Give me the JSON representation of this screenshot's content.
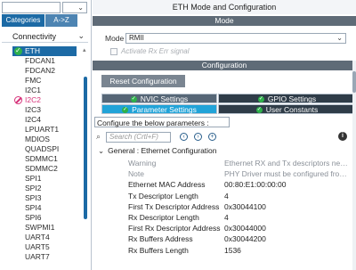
{
  "left_panel": {
    "tabs": {
      "categories": "Categories",
      "az": "A->Z"
    },
    "category": "Connectivity",
    "items": [
      {
        "label": "ETH",
        "state": "selected-ok"
      },
      {
        "label": "FDCAN1",
        "state": "normal"
      },
      {
        "label": "FDCAN2",
        "state": "normal"
      },
      {
        "label": "FMC",
        "state": "normal"
      },
      {
        "label": "I2C1",
        "state": "normal"
      },
      {
        "label": "I2C2",
        "state": "conflict"
      },
      {
        "label": "I2C3",
        "state": "normal"
      },
      {
        "label": "I2C4",
        "state": "normal"
      },
      {
        "label": "LPUART1",
        "state": "normal"
      },
      {
        "label": "MDIOS",
        "state": "normal"
      },
      {
        "label": "QUADSPI",
        "state": "normal"
      },
      {
        "label": "SDMMC1",
        "state": "normal"
      },
      {
        "label": "SDMMC2",
        "state": "normal"
      },
      {
        "label": "SPI1",
        "state": "normal"
      },
      {
        "label": "SPI2",
        "state": "normal"
      },
      {
        "label": "SPI3",
        "state": "normal"
      },
      {
        "label": "SPI4",
        "state": "normal"
      },
      {
        "label": "SPI6",
        "state": "normal"
      },
      {
        "label": "SWPMI1",
        "state": "normal"
      },
      {
        "label": "UART4",
        "state": "normal"
      },
      {
        "label": "UART5",
        "state": "normal"
      },
      {
        "label": "UART7",
        "state": "normal"
      }
    ]
  },
  "right_panel": {
    "title": "ETH Mode and Configuration",
    "mode_header": "Mode",
    "mode_label": "Mode",
    "mode_value": "RMII",
    "activate_label": "Activate Rx Err signal",
    "config_header": "Configuration",
    "reset_button": "Reset Configuration",
    "tabs": {
      "nvic": "NVIC Settings",
      "gpio": "GPIO Settings",
      "param": "Parameter Settings",
      "user": "User Constants"
    },
    "configure_label": "Configure the below parameters :",
    "search_placeholder": "Search (Crtl+F)",
    "group_title": "General : Ethernet Configuration",
    "params": [
      {
        "key": "Warning",
        "value": "Ethernet RX and Tx descriptors need...",
        "style": "dim"
      },
      {
        "key": "Note",
        "value": "PHY Driver must be configured from t...",
        "style": "dim"
      },
      {
        "key": "Ethernet MAC Address",
        "value": "00:80:E1:00:00:00",
        "style": "norm"
      },
      {
        "key": "Tx Descriptor Length",
        "value": "4",
        "style": "norm"
      },
      {
        "key": "First Tx Descriptor Address",
        "value": "0x30044100",
        "style": "norm"
      },
      {
        "key": "Rx Descriptor Length",
        "value": "4",
        "style": "norm"
      },
      {
        "key": "First Rx Descriptor Address",
        "value": "0x30044000",
        "style": "norm"
      },
      {
        "key": "Rx Buffers Address",
        "value": "0x30044200",
        "style": "norm"
      },
      {
        "key": "Rx Buffers Length",
        "value": "1536",
        "style": "norm"
      }
    ]
  },
  "icons": {
    "ok": "check-circle-icon",
    "conflict": "no-entry-icon",
    "search": "search-icon",
    "info": "info-icon"
  },
  "colors": {
    "accent": "#1c6aa5",
    "ok": "#2eb14a",
    "conflict": "#d6337a",
    "param_tab": "#21a3d8"
  }
}
